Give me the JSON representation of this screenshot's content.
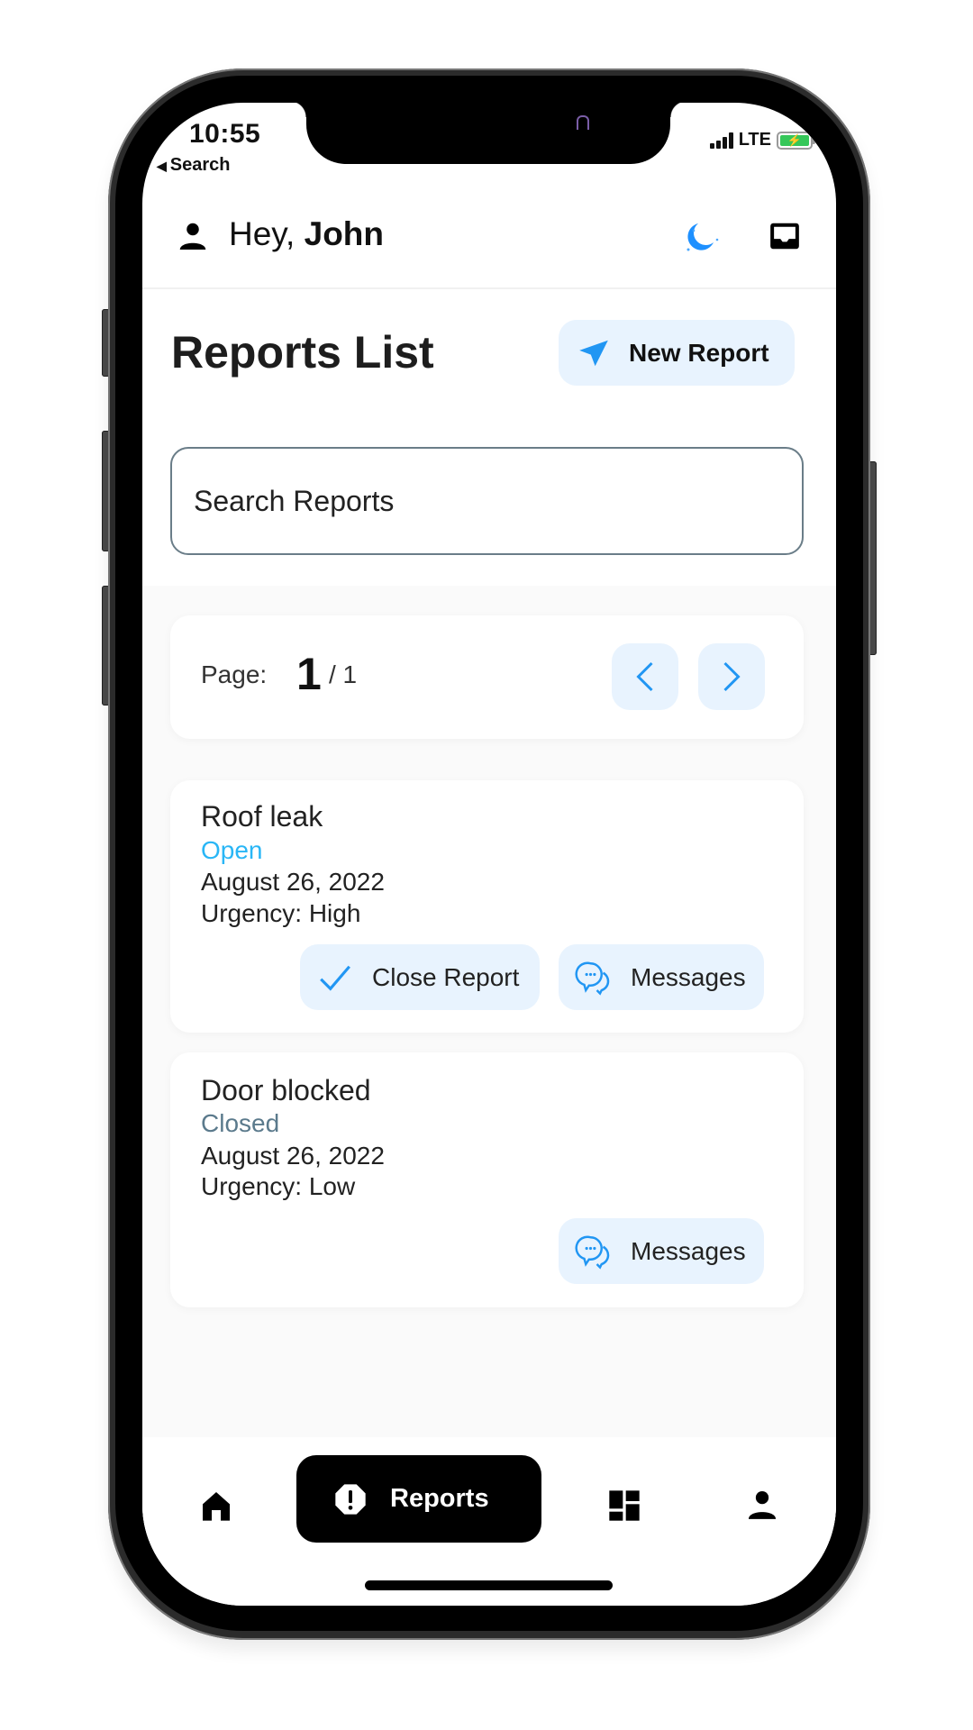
{
  "status_bar": {
    "time": "10:55",
    "back_label": "Search",
    "network": "LTE",
    "battery_charging": true
  },
  "header": {
    "greeting_prefix": "Hey,",
    "user_name": "John",
    "icons": [
      "user-icon",
      "moon-icon",
      "inbox-icon"
    ]
  },
  "page": {
    "title": "Reports List",
    "new_report_label": "New Report",
    "search_placeholder": "Search Reports"
  },
  "pagination": {
    "label": "Page:",
    "current": "1",
    "total": "/ 1"
  },
  "reports": [
    {
      "title": "Roof leak",
      "status": "Open",
      "date": "August 26, 2022",
      "urgency": "Urgency: High",
      "actions": [
        "Close Report",
        "Messages"
      ]
    },
    {
      "title": "Door blocked",
      "status": "Closed",
      "date": "August 26, 2022",
      "urgency": "Urgency: Low",
      "actions": [
        "Messages"
      ]
    }
  ],
  "bottom_nav": {
    "items": [
      {
        "name": "home",
        "label": ""
      },
      {
        "name": "reports",
        "label": "Reports",
        "active": true
      },
      {
        "name": "dashboard",
        "label": ""
      },
      {
        "name": "profile",
        "label": ""
      }
    ]
  },
  "colors": {
    "accent": "#2196f3",
    "button_bg": "#e8f3fe",
    "status_open": "#29b6f6",
    "status_closed": "#5b7a8c",
    "nav_active_bg": "#000000"
  }
}
